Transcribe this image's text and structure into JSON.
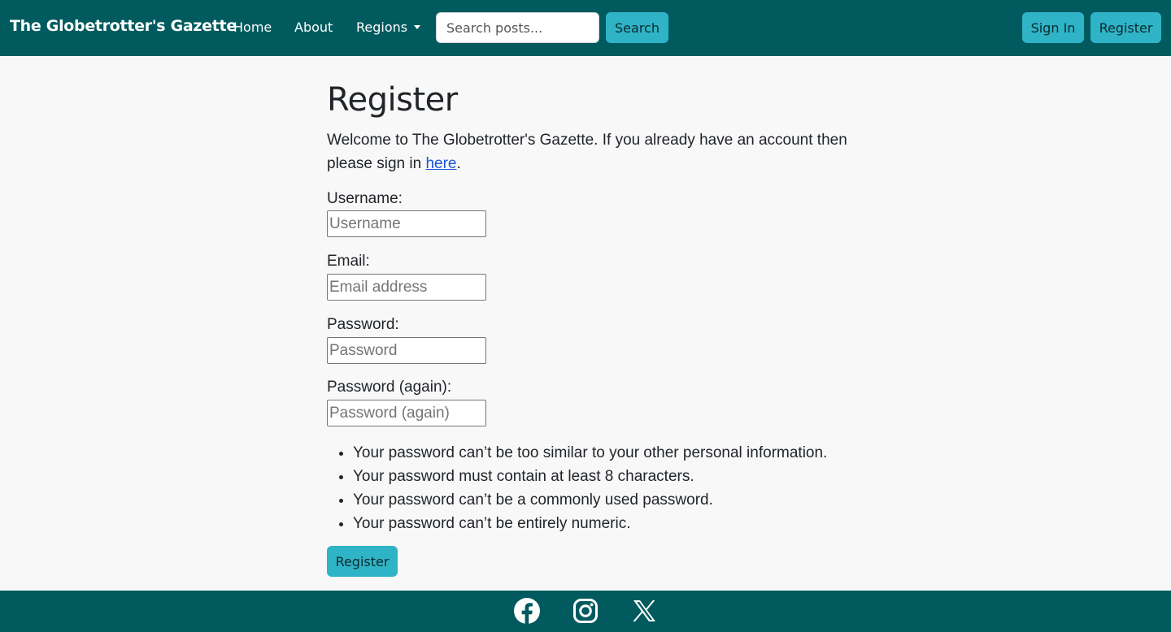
{
  "colors": {
    "navbar_bg": "#005a5e",
    "button_teal": "#2fb3c6",
    "link_blue": "#1a55e0",
    "page_bg": "#f8f8f8"
  },
  "navbar": {
    "brand": "The Globetrotter's Gazette",
    "links": {
      "home": "Home",
      "about": "About",
      "regions": "Regions"
    },
    "search": {
      "placeholder": "Search posts...",
      "button": "Search"
    },
    "sign_in": "Sign In",
    "register": "Register"
  },
  "main": {
    "title": "Register",
    "intro_text": "Welcome to The Globetrotter's Gazette. If you already have an account then please sign in ",
    "intro_link": "here",
    "intro_end": ".",
    "fields": {
      "username": {
        "label": "Username:",
        "placeholder": "Username",
        "value": ""
      },
      "email": {
        "label": "Email:",
        "placeholder": "Email address",
        "value": ""
      },
      "password": {
        "label": "Password:",
        "placeholder": "Password",
        "value": ""
      },
      "password2": {
        "label": "Password (again):",
        "placeholder": "Password (again)",
        "value": ""
      }
    },
    "password_rules": [
      "Your password can’t be too similar to your other personal information.",
      "Your password must contain at least 8 characters.",
      "Your password can’t be a commonly used password.",
      "Your password can’t be entirely numeric."
    ],
    "submit": "Register"
  },
  "footer": {
    "icons": [
      "facebook-icon",
      "instagram-icon",
      "x-twitter-icon"
    ]
  }
}
